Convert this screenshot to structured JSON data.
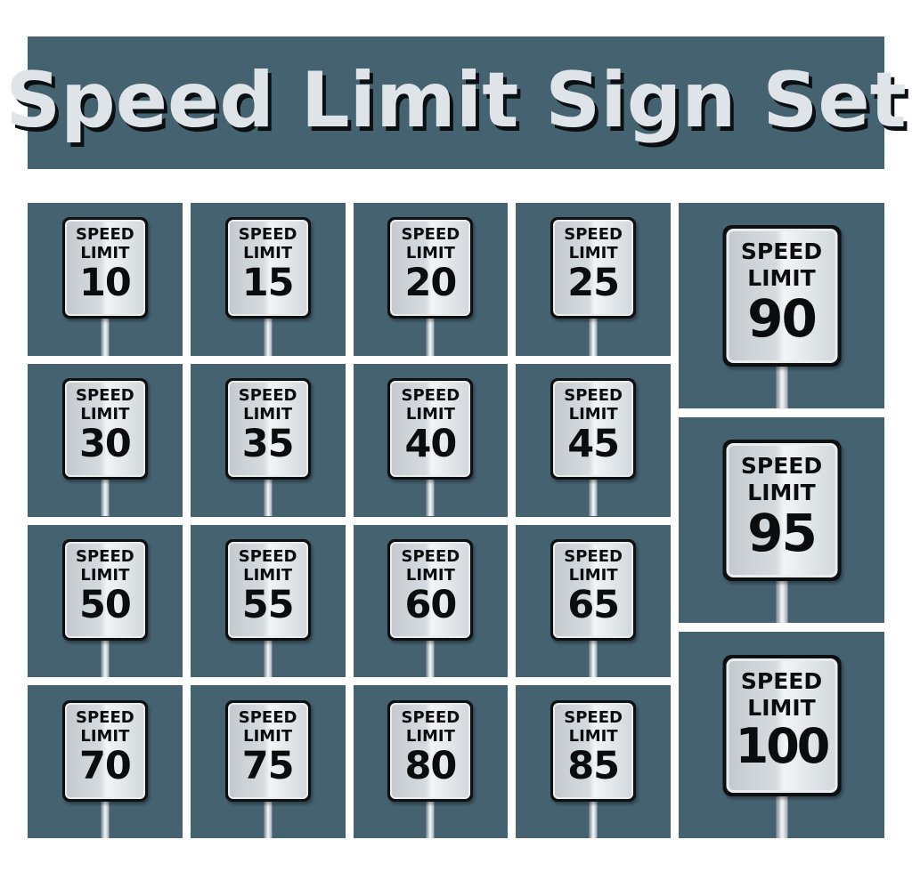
{
  "page": {
    "background_color": "#ffffff",
    "panel_color": "#456271",
    "sign_face_color": "#d8dee1",
    "sign_border_color": "#0d0f11",
    "pole_color": "#cdd4d9",
    "title_text_color": "#dfe4e8",
    "title_shadow_color": "#0b0f12"
  },
  "header": {
    "title": "Speed Limit Sign Set"
  },
  "sign_labels": {
    "line1": "SPEED",
    "line2": "LIMIT"
  },
  "grid": {
    "columns": 4,
    "rows": 4,
    "signs": [
      {
        "value": "10"
      },
      {
        "value": "15"
      },
      {
        "value": "20"
      },
      {
        "value": "25"
      },
      {
        "value": "30"
      },
      {
        "value": "35"
      },
      {
        "value": "40"
      },
      {
        "value": "45"
      },
      {
        "value": "50"
      },
      {
        "value": "55"
      },
      {
        "value": "60"
      },
      {
        "value": "65"
      },
      {
        "value": "70"
      },
      {
        "value": "75"
      },
      {
        "value": "80"
      },
      {
        "value": "85"
      }
    ]
  },
  "feature_column": {
    "signs": [
      {
        "value": "90"
      },
      {
        "value": "95"
      },
      {
        "value": "100"
      }
    ]
  }
}
